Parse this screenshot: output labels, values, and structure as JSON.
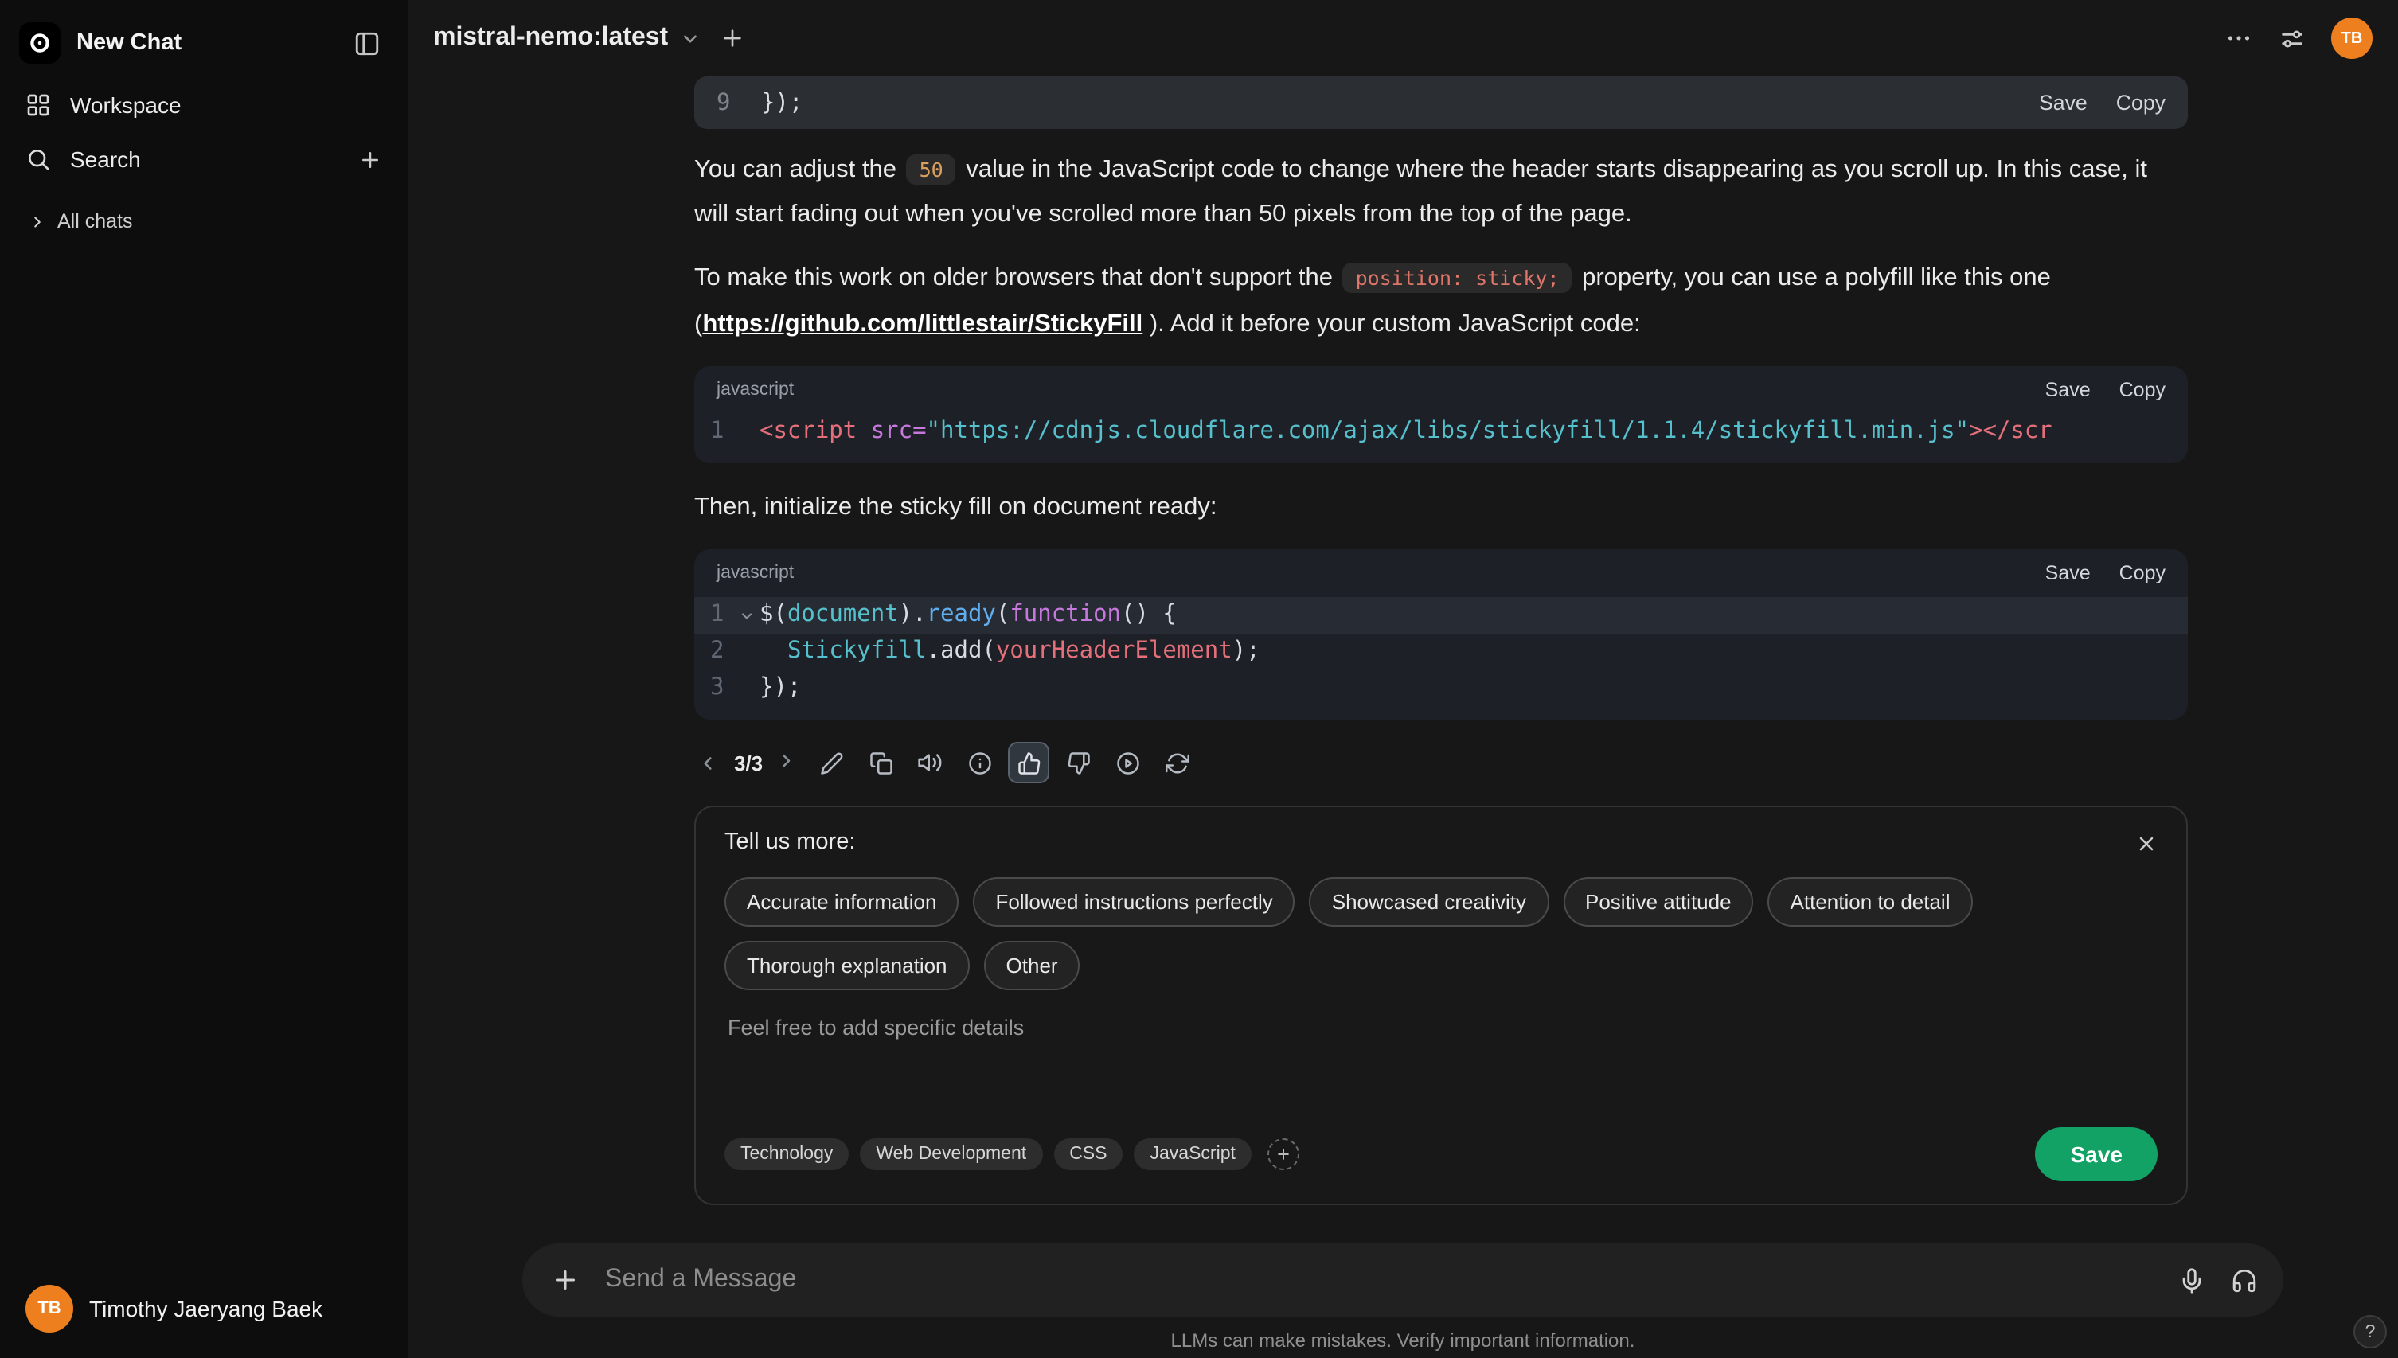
{
  "colors": {
    "save_button_green": "#12a265",
    "avatar_orange": "#ee7f1e"
  },
  "app": {
    "help_label": "?"
  },
  "sidebar": {
    "new_chat_label": "New Chat",
    "workspace_label": "Workspace",
    "search_label": "Search",
    "all_chats_label": "All chats",
    "user": {
      "name": "Timothy Jaeryang Baek",
      "initials": "TB"
    }
  },
  "header": {
    "model_name": "mistral-nemo:latest",
    "avatar_initials": "TB"
  },
  "message": {
    "fragment": {
      "line_no": "9",
      "code": "});",
      "save": "Save",
      "copy": "Copy"
    },
    "para1": {
      "before": "You can adjust the ",
      "code": "50",
      "after": " value in the JavaScript code to change where the header starts disappearing as you scroll up. In this case, it will start fading out when you've scrolled more than 50 pixels from the top of the page."
    },
    "para2": {
      "before": "To make this work on older browsers that don't support the ",
      "code": "position: sticky;",
      "mid": " property, you can use a polyfill like this one (",
      "link": "https://github.com/littlestair/StickyFill",
      "after": " ). Add it before your custom JavaScript code:"
    },
    "code1": {
      "lang": "javascript",
      "save": "Save",
      "copy": "Copy",
      "lines": [
        {
          "no": "1",
          "tokens": [
            {
              "t": "<script",
              "c": "red"
            },
            {
              "t": " ",
              "c": "plain"
            },
            {
              "t": "src=",
              "c": "purple"
            },
            {
              "t": "\"https://cdnjs.cloudflare.com/ajax/libs/stickyfill/1.1.4/stickyfill.min.js\"",
              "c": "cyan"
            },
            {
              "t": "></scr",
              "c": "red"
            }
          ]
        }
      ]
    },
    "para3": "Then, initialize the sticky fill on document ready:",
    "code2": {
      "lang": "javascript",
      "save": "Save",
      "copy": "Copy",
      "lines": [
        {
          "no": "1",
          "fold": true,
          "highlight": true,
          "tokens": [
            {
              "t": "$(",
              "c": "plain"
            },
            {
              "t": "document",
              "c": "cyan"
            },
            {
              "t": ").",
              "c": "plain"
            },
            {
              "t": "ready",
              "c": "blue"
            },
            {
              "t": "(",
              "c": "plain"
            },
            {
              "t": "function",
              "c": "purple"
            },
            {
              "t": "() {",
              "c": "plain"
            }
          ]
        },
        {
          "no": "2",
          "tokens": [
            {
              "t": "  ",
              "c": "plain"
            },
            {
              "t": "Stickyfill",
              "c": "cyan"
            },
            {
              "t": ".add(",
              "c": "plain"
            },
            {
              "t": "yourHeaderElement",
              "c": "red"
            },
            {
              "t": ");",
              "c": "plain"
            }
          ]
        },
        {
          "no": "3",
          "tokens": [
            {
              "t": "});",
              "c": "plain"
            }
          ]
        }
      ]
    },
    "pager": {
      "current": "3/3"
    }
  },
  "feedback": {
    "title": "Tell us more:",
    "options": [
      "Accurate information",
      "Followed instructions perfectly",
      "Showcased creativity",
      "Positive attitude",
      "Attention to detail",
      "Thorough explanation",
      "Other"
    ],
    "details_placeholder": "Feel free to add specific details",
    "tags": [
      "Technology",
      "Web Development",
      "CSS",
      "JavaScript"
    ],
    "save_label": "Save"
  },
  "composer": {
    "placeholder": "Send a Message"
  },
  "footer": {
    "disclaimer": "LLMs can make mistakes. Verify important information."
  }
}
